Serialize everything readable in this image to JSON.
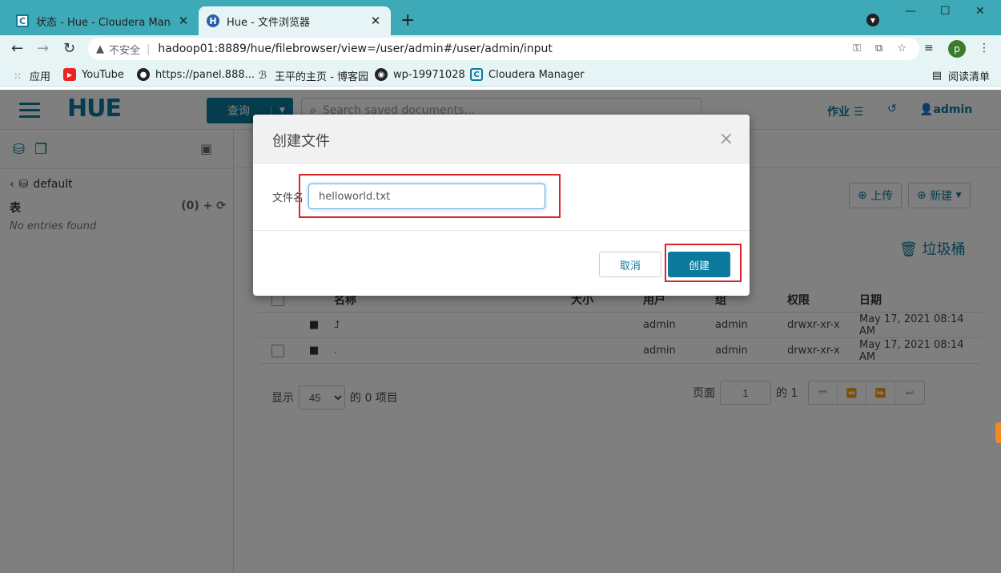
{
  "browser": {
    "tabs": [
      {
        "title": "状态 - Hue - Cloudera Manager",
        "active": false
      },
      {
        "title": "Hue - 文件浏览器",
        "active": true
      }
    ],
    "new_tab": "+",
    "url": "hadoop01:8889/hue/filebrowser/view=/user/admin#/user/admin/input",
    "insecure_label": "不安全",
    "profile_initial": "p",
    "bookmarks": [
      "应用",
      "YouTube",
      "https://panel.888...",
      "王平的主页 - 博客园",
      "wp-19971028",
      "Cloudera Manager"
    ],
    "reading_list": "阅读清单"
  },
  "hue": {
    "logo": "HUE",
    "query_button": "查询",
    "search_placeholder": "Search saved documents...",
    "jobs": "作业",
    "user": "admin",
    "left": {
      "database": "default",
      "tables_label": "表",
      "tables_count": "(0)",
      "empty_text": "No entries found"
    },
    "main": {
      "upload": "上传",
      "new": "新建",
      "trash": "垃圾桶",
      "columns": [
        "名称",
        "大小",
        "用户",
        "组",
        "权限",
        "日期"
      ],
      "rows": [
        {
          "name": "⮥",
          "user": "admin",
          "group": "admin",
          "perm": "drwxr-xr-x",
          "date": "May 17, 2021 08:14 AM"
        },
        {
          "name": ".",
          "user": "admin",
          "group": "admin",
          "perm": "drwxr-xr-x",
          "date": "May 17, 2021 08:14 AM"
        }
      ],
      "show_label": "显示",
      "page_size": "45",
      "items_label": "的 0 项目",
      "page_label": "页面",
      "page_value": "1",
      "of_label": "的 1"
    }
  },
  "modal": {
    "title": "创建文件",
    "close": "×",
    "field_label": "文件名",
    "field_value": "helloworld.txt",
    "cancel": "取消",
    "create": "创建"
  },
  "colors": {
    "accent": "#0b7a9c",
    "tabbar": "#3ea9b7",
    "highlight": "#d8232a"
  }
}
